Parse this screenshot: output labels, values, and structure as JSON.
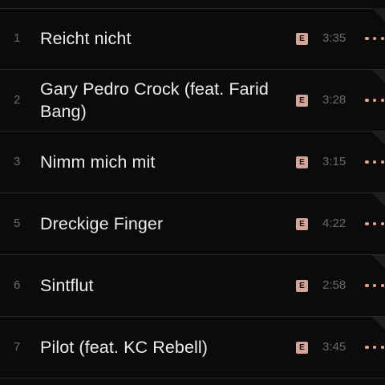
{
  "tracks": [
    {
      "number": "1",
      "title": "Reicht nicht",
      "explicit": "E",
      "duration": "3:35"
    },
    {
      "number": "2",
      "title": "Gary Pedro Crock (feat. Farid Bang)",
      "explicit": "E",
      "duration": "3:28"
    },
    {
      "number": "3",
      "title": "Nimm mich mit",
      "explicit": "E",
      "duration": "3:15"
    },
    {
      "number": "5",
      "title": "Dreckige Finger",
      "explicit": "E",
      "duration": "4:22"
    },
    {
      "number": "6",
      "title": "Sintflut",
      "explicit": "E",
      "duration": "2:58"
    },
    {
      "number": "7",
      "title": "Pilot (feat. KC Rebell)",
      "explicit": "E",
      "duration": "3:45"
    }
  ],
  "colors": {
    "background": "#0b0b0b",
    "accent": "#e2a58e",
    "explicit_badge": "#d3a598",
    "divider": "#2a2a2a"
  },
  "icons": {
    "more": "more-dots-icon",
    "explicit": "explicit-badge"
  }
}
